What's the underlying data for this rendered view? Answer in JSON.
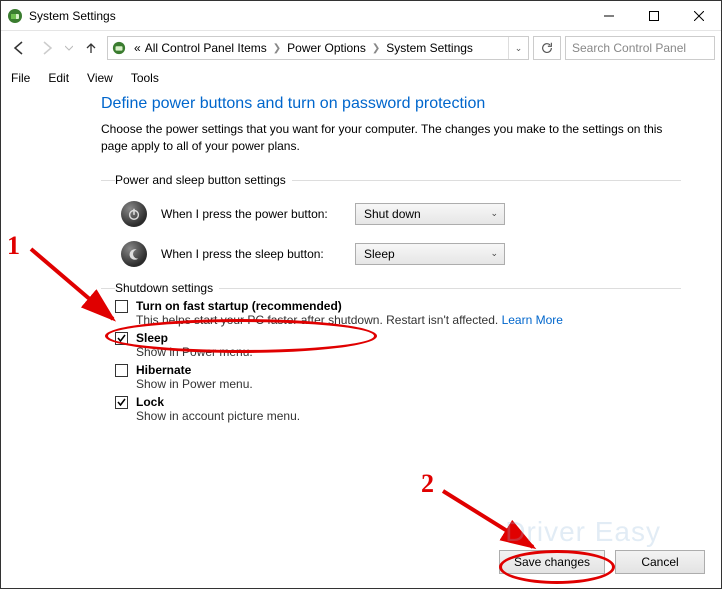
{
  "title": "System Settings",
  "breadcrumbs": {
    "root_symbol": "«",
    "item0": "All Control Panel Items",
    "item1": "Power Options",
    "item2": "System Settings"
  },
  "search": {
    "placeholder": "Search Control Panel"
  },
  "menu": {
    "file": "File",
    "edit": "Edit",
    "view": "View",
    "tools": "Tools"
  },
  "page": {
    "heading": "Define power buttons and turn on password protection",
    "description": "Choose the power settings that you want for your computer. The changes you make to the settings on this page apply to all of your power plans."
  },
  "section_power_sleep": {
    "legend": "Power and sleep button settings",
    "power_button_label": "When I press the power button:",
    "power_button_value": "Shut down",
    "sleep_button_label": "When I press the sleep button:",
    "sleep_button_value": "Sleep"
  },
  "section_shutdown": {
    "legend": "Shutdown settings",
    "fast_startup": {
      "label": "Turn on fast startup (recommended)",
      "desc": "This helps start your PC faster after shutdown. Restart isn't affected. ",
      "learn_more": "Learn More"
    },
    "sleep": {
      "label": "Sleep",
      "desc": "Show in Power menu."
    },
    "hibernate": {
      "label": "Hibernate",
      "desc": "Show in Power menu."
    },
    "lock": {
      "label": "Lock",
      "desc": "Show in account picture menu."
    }
  },
  "buttons": {
    "save": "Save changes",
    "cancel": "Cancel"
  },
  "annotations": {
    "one": "1",
    "two": "2"
  }
}
